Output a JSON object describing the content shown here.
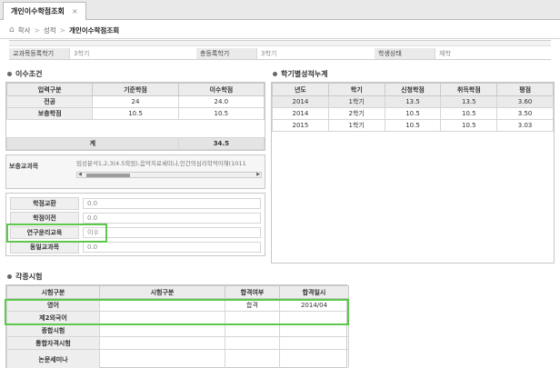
{
  "tab": {
    "label": "개인이수학점조회",
    "close": "×"
  },
  "breadcrumb": {
    "items": [
      "학사",
      "성적",
      "개인이수학점조회"
    ],
    "sep": ">"
  },
  "info": {
    "fields": [
      {
        "label": "교과목등록학기",
        "value": "3학기"
      },
      {
        "label": "총등록학기",
        "value": "3학기"
      },
      {
        "label": "학생상태",
        "value": "재학"
      }
    ]
  },
  "completion": {
    "title": "이수조건",
    "columns": [
      "입력구분",
      "기준학점",
      "이수학점"
    ],
    "rows": [
      [
        "전공",
        "24",
        "24.0"
      ],
      [
        "보충학점",
        "10.5",
        "10.5"
      ]
    ],
    "total_label": "계",
    "total_value": "34.5"
  },
  "supp_course": {
    "label": "보충교과목",
    "value": "임상분석1,2,3(4.5학점),음악치료세미나,인간의심리학적이해(1011"
  },
  "credits": [
    {
      "label": "학점교환",
      "value": "0.0"
    },
    {
      "label": "학점이전",
      "value": "0.0"
    },
    {
      "label": "연구윤리교육",
      "value": "이수"
    },
    {
      "label": "동일교과목",
      "value": "0.0"
    }
  ],
  "semester": {
    "title": "학기별성적누계",
    "columns": [
      "년도",
      "학기",
      "신청학점",
      "취득학점",
      "평점"
    ],
    "rows": [
      [
        "2014",
        "1학기",
        "13.5",
        "13.5",
        "3.60"
      ],
      [
        "2014",
        "2학기",
        "10.5",
        "10.5",
        "3.50"
      ],
      [
        "2015",
        "1학기",
        "10.5",
        "10.5",
        "3.03"
      ]
    ]
  },
  "exams": {
    "title": "각종시험",
    "columns": [
      "시험구분",
      "시험구분",
      "합격여부",
      "합격일시"
    ],
    "rows": [
      [
        "영어",
        "",
        "합격",
        "2014/04"
      ],
      [
        "제2외국어",
        "",
        "",
        ""
      ],
      [
        "종합시험",
        "",
        "",
        ""
      ],
      [
        "통합자격시험",
        "",
        "",
        ""
      ],
      [
        "논문세미나",
        "",
        "",
        ""
      ]
    ]
  },
  "colors": {
    "highlight": "#5ec84d",
    "header_bg": "#ececec",
    "selected_row": "#eaeaea"
  }
}
